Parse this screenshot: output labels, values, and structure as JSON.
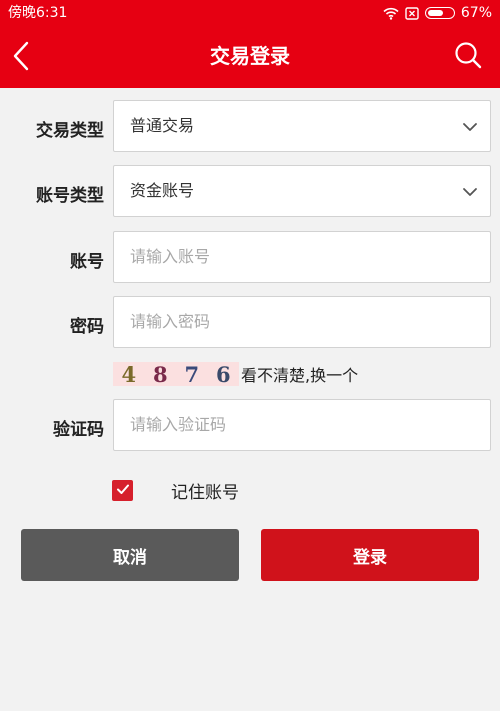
{
  "status": {
    "time": "傍晚6:31",
    "battery": "67%",
    "battery_level": 0.67
  },
  "nav": {
    "title": "交易登录"
  },
  "form": {
    "trade_type": {
      "label": "交易类型",
      "value": "普通交易"
    },
    "account_type": {
      "label": "账号类型",
      "value": "资金账号"
    },
    "account": {
      "label": "账号",
      "placeholder": "请输入账号"
    },
    "password": {
      "label": "密码",
      "placeholder": "请输入密码"
    },
    "captcha": {
      "digits": [
        "4",
        "8",
        "7",
        "6"
      ],
      "refresh_text": "看不清楚,换一个"
    },
    "verify_code": {
      "label": "验证码",
      "placeholder": "请输入验证码"
    },
    "remember": {
      "label": "记住账号",
      "checked": true
    }
  },
  "buttons": {
    "cancel": "取消",
    "login": "登录"
  },
  "colors": {
    "header": "#e60012",
    "login_button": "#d0121b",
    "cancel_button": "#5a5a5a",
    "checkbox": "#d6202c",
    "background": "#f2f2f2"
  }
}
